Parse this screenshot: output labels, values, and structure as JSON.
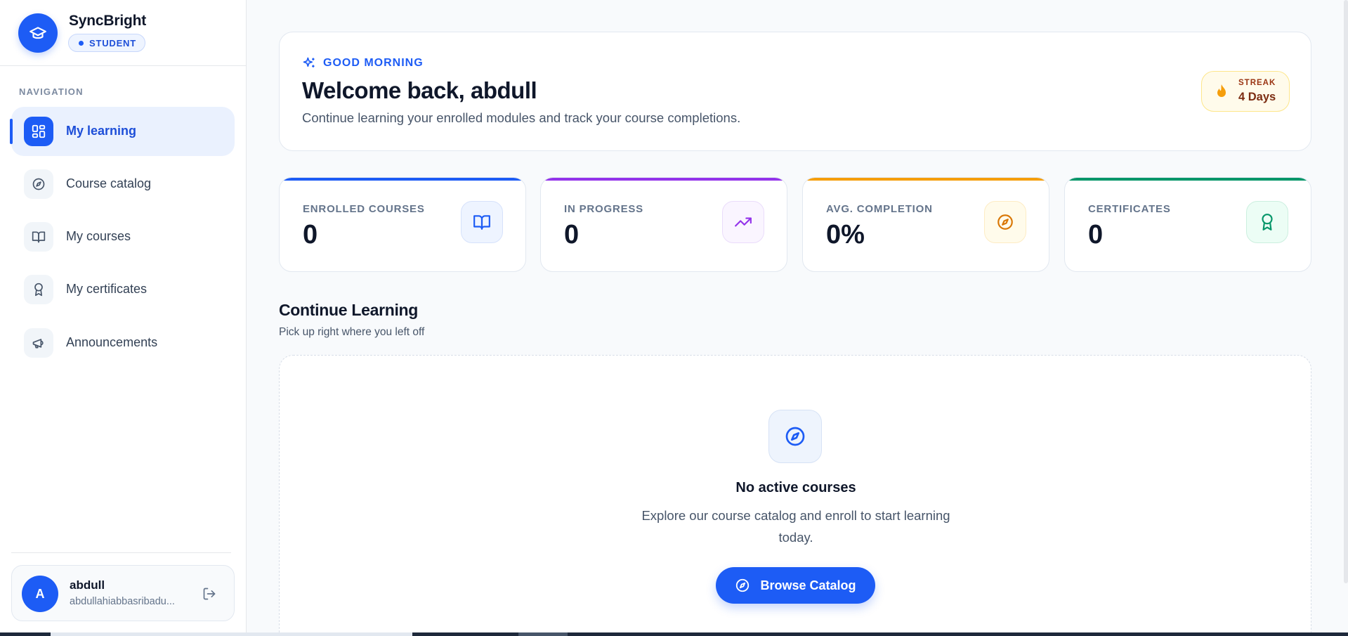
{
  "brand": {
    "name": "SyncBright",
    "role": "STUDENT"
  },
  "sidebar": {
    "heading": "NAVIGATION",
    "items": [
      {
        "label": "My learning",
        "icon": "dashboard-icon",
        "active": true
      },
      {
        "label": "Course catalog",
        "icon": "compass-icon",
        "active": false
      },
      {
        "label": "My courses",
        "icon": "book-open-icon",
        "active": false
      },
      {
        "label": "My certificates",
        "icon": "award-icon",
        "active": false
      },
      {
        "label": "Announcements",
        "icon": "megaphone-icon",
        "active": false
      }
    ]
  },
  "user": {
    "initial": "A",
    "name": "abdull",
    "email": "abdullahiabbasribadu..."
  },
  "hero": {
    "greeting": "GOOD MORNING",
    "title": "Welcome back, abdull",
    "subtitle": "Continue learning your enrolled modules and track your course completions.",
    "streak_label": "STREAK",
    "streak_value": "4 Days"
  },
  "stats": [
    {
      "label": "ENROLLED COURSES",
      "value": "0",
      "color": "#1d5cf5",
      "icon": "book-open-icon"
    },
    {
      "label": "IN PROGRESS",
      "value": "0",
      "color": "#9333ea",
      "icon": "trending-up-icon"
    },
    {
      "label": "AVG. COMPLETION",
      "value": "0%",
      "color": "#f59e0b",
      "icon": "compass-icon"
    },
    {
      "label": "CERTIFICATES",
      "value": "0",
      "color": "#059669",
      "icon": "award-icon"
    }
  ],
  "continue": {
    "title": "Continue Learning",
    "subtitle": "Pick up right where you left off"
  },
  "empty_state": {
    "title": "No active courses",
    "text": "Explore our course catalog and enroll to start learning today.",
    "button": "Browse Catalog"
  },
  "colors": {
    "primary": "#1d5cf5",
    "purple": "#9333ea",
    "amber": "#f59e0b",
    "green": "#059669"
  }
}
